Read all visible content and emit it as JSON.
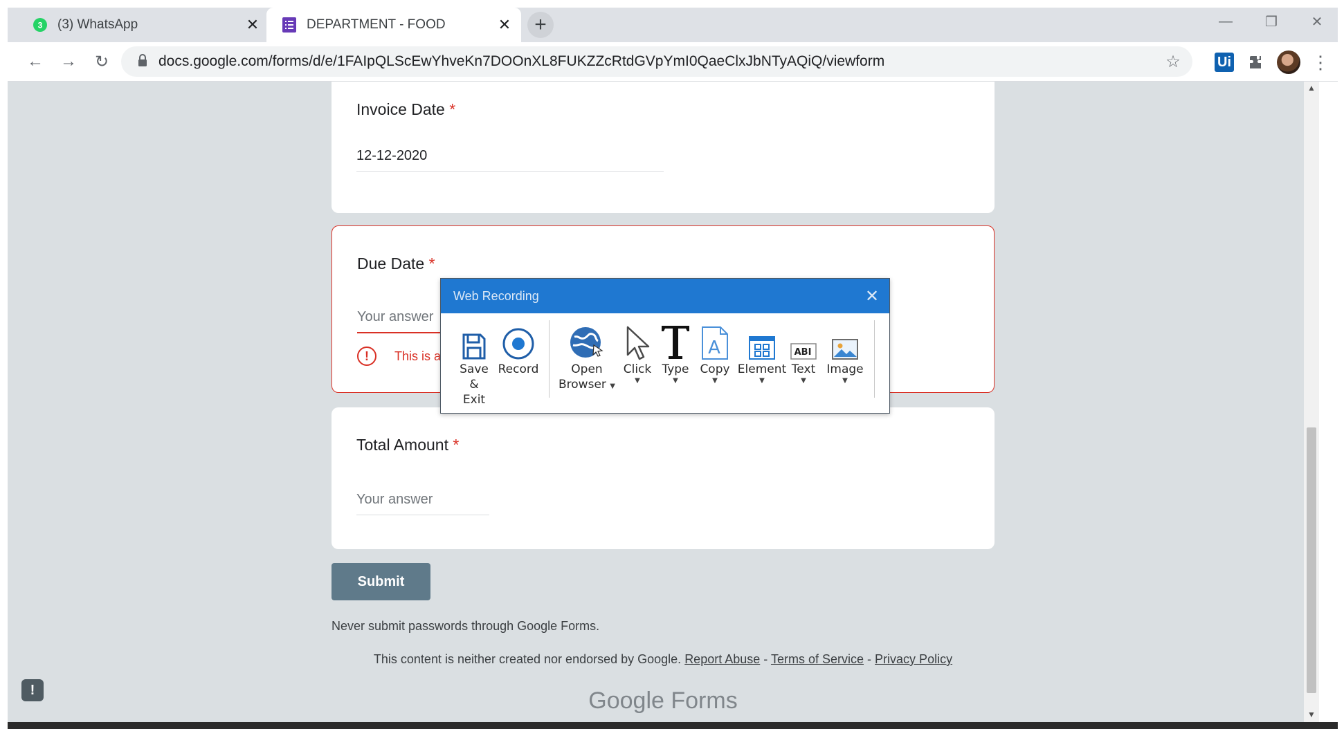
{
  "browser": {
    "tabs": [
      {
        "label": "(3) WhatsApp",
        "badge": "3",
        "active": false
      },
      {
        "label": "DEPARTMENT - FOOD",
        "active": true
      }
    ],
    "url": "docs.google.com/forms/d/e/1FAIpQLScEwYhveKn7DOOnXL8FUKZZcRtdGVpYmI0QaeClxJbNTyAQiQ/viewform",
    "extension_label": "Ui",
    "colors": {
      "whatsapp": "#25d366",
      "forms": "#673ab7",
      "uipath": "#0f61b0"
    }
  },
  "form": {
    "questions": [
      {
        "title": "Invoice Date",
        "required_mark": "*",
        "value": "12-12-2020"
      },
      {
        "title": "Due Date",
        "required_mark": "*",
        "placeholder": "Your answer",
        "error": "This is a required question"
      },
      {
        "title": "Total Amount",
        "required_mark": "*",
        "placeholder": "Your answer"
      }
    ],
    "submit_label": "Submit",
    "password_note": "Never submit passwords through Google Forms.",
    "disclaimer": "This content is neither created nor endorsed by Google.",
    "links": [
      "Report Abuse",
      "Terms of Service",
      "Privacy Policy"
    ],
    "separator": "-",
    "brand_google": "Google",
    "brand_forms": "Forms"
  },
  "recorder": {
    "title": "Web Recording",
    "tools": [
      {
        "line1": "Save",
        "line2": "& Exit",
        "icon": "save-icon"
      },
      {
        "line1": "Record",
        "icon": "record-icon"
      },
      {
        "line1": "Open",
        "line2": "Browser",
        "icon": "globe-icon",
        "dropdown": true
      },
      {
        "line1": "Click",
        "icon": "cursor-icon",
        "dropdown": true
      },
      {
        "line1": "Type",
        "icon": "type-icon",
        "dropdown": true
      },
      {
        "line1": "Copy",
        "icon": "copy-icon",
        "dropdown": true
      },
      {
        "line1": "Element",
        "icon": "element-icon",
        "dropdown": true
      },
      {
        "line1": "Text",
        "icon": "text-icon",
        "dropdown": true
      },
      {
        "line1": "Image",
        "icon": "image-icon",
        "dropdown": true
      }
    ],
    "text_icon_glyph": "ABI"
  }
}
